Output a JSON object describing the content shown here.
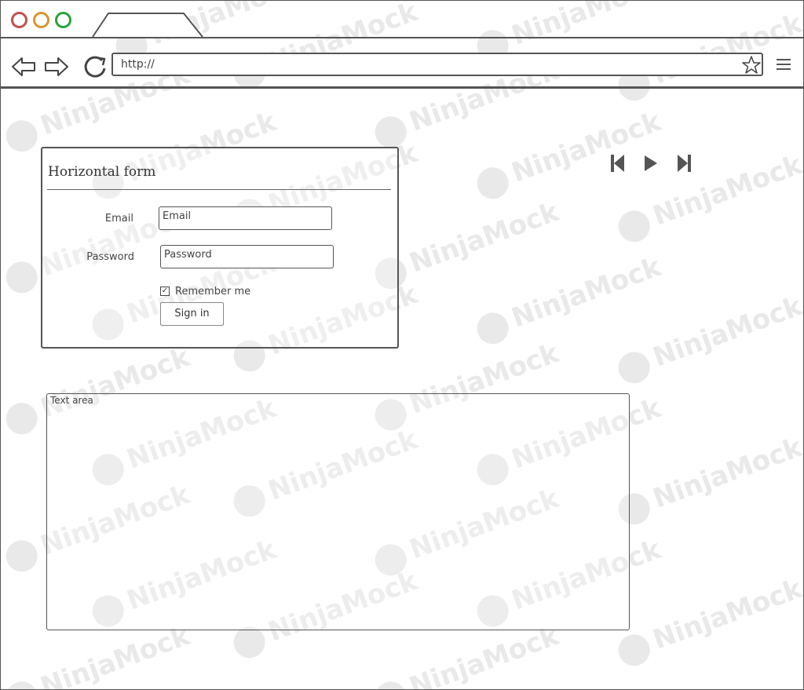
{
  "browser": {
    "url": "http://",
    "window_controls": [
      "close",
      "minimize",
      "maximize"
    ],
    "icons": {
      "back": "arrow-left-icon",
      "forward": "arrow-right-icon",
      "reload": "reload-icon",
      "bookmark": "star-icon",
      "menu": "hamburger-menu-icon"
    }
  },
  "watermark": "NinjaMock",
  "form": {
    "title": "Horizontal form",
    "email_label": "Email",
    "email_placeholder": "Email",
    "password_label": "Password",
    "password_placeholder": "Password",
    "remember_label": "Remember me",
    "remember_checked": true,
    "signin_label": "Sign in"
  },
  "media_controls": {
    "icons": [
      "skip-back-icon",
      "play-icon",
      "skip-forward-icon"
    ]
  },
  "textarea": {
    "label": "Text area"
  },
  "colors": {
    "close": "#c0504d",
    "minimize": "#d9952b",
    "maximize": "#2aa13a",
    "stroke": "#555555"
  }
}
